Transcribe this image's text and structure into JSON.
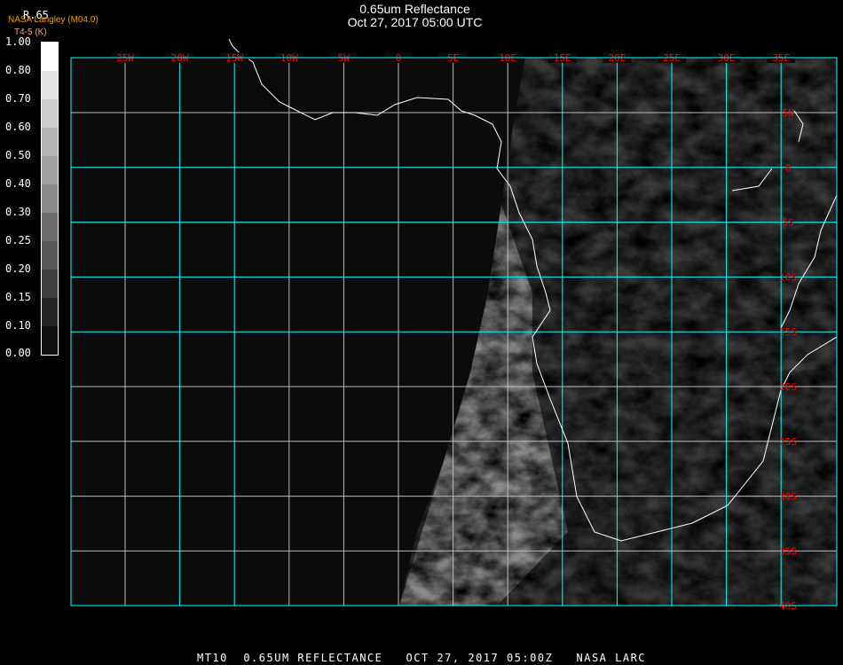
{
  "header": {
    "title": "0.65um Reflectance",
    "datetime": "Oct 27, 2017 05:00 UTC",
    "product": "NASA Langley (M04.0)",
    "channel": "R.65",
    "units": "T4-5 (K)"
  },
  "colorbar": {
    "labels": [
      "1.00",
      "0.80",
      "0.70",
      "0.60",
      "0.50",
      "0.40",
      "0.30",
      "0.25",
      "0.20",
      "0.15",
      "0.10",
      "0.00"
    ],
    "colors": [
      "#ffffff",
      "#e4e4e4",
      "#cccccc",
      "#b4b4b4",
      "#a0a0a0",
      "#888888",
      "#6c6c6c",
      "#585858",
      "#404040",
      "#242424",
      "#101010"
    ]
  },
  "map": {
    "lon_labels": [
      "25W",
      "20W",
      "15W",
      "10W",
      "5W",
      "0",
      "5E",
      "10E",
      "15E",
      "20E",
      "25E",
      "30E",
      "35E"
    ],
    "lat_labels": [
      "5N",
      "0",
      "5S",
      "10S",
      "15S",
      "20S",
      "25S",
      "30S",
      "35S",
      "40S"
    ],
    "grid_color": "#00ffff",
    "label_color": "#ff0000"
  },
  "footer": "MT10  0.65UM REFLECTANCE   OCT 27, 2017 05:00Z   NASA LARC"
}
